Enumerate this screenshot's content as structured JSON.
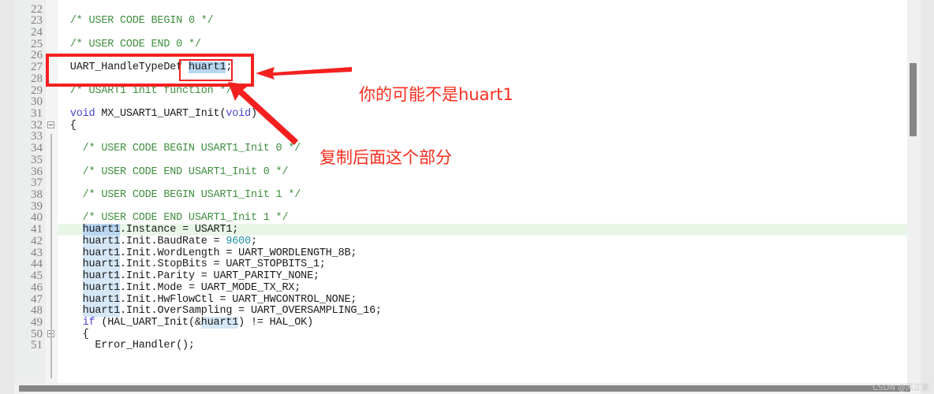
{
  "editor": {
    "first_line": 22,
    "last_line": 51,
    "lines": [
      {
        "n": 22,
        "html": ""
      },
      {
        "n": 23,
        "html": "  <span class=\"cmt\">/* USER CODE BEGIN 0 */</span>"
      },
      {
        "n": 24,
        "html": ""
      },
      {
        "n": 25,
        "html": "  <span class=\"cmt\">/* USER CODE END 0 */</span>"
      },
      {
        "n": 26,
        "html": ""
      },
      {
        "n": 27,
        "html": "  UART_HandleTypeDef <span class=\"sel\">huart1</span>;"
      },
      {
        "n": 28,
        "html": ""
      },
      {
        "n": 29,
        "html": "  <span class=\"cmt\">/* USART1 init function */</span>"
      },
      {
        "n": 30,
        "html": ""
      },
      {
        "n": 31,
        "html": "  <span class=\"kw\">void</span> MX_USART1_UART_Init(<span class=\"kw\">void</span>)"
      },
      {
        "n": 32,
        "html": "  {"
      },
      {
        "n": 33,
        "html": ""
      },
      {
        "n": 34,
        "html": "    <span class=\"cmt\">/* USER CODE BEGIN USART1_Init 0 */</span>"
      },
      {
        "n": 35,
        "html": ""
      },
      {
        "n": 36,
        "html": "    <span class=\"cmt\">/* USER CODE END USART1_Init 0 */</span>"
      },
      {
        "n": 37,
        "html": ""
      },
      {
        "n": 38,
        "html": "    <span class=\"cmt\">/* USER CODE BEGIN USART1_Init 1 */</span>"
      },
      {
        "n": 39,
        "html": ""
      },
      {
        "n": 40,
        "html": "    <span class=\"cmt\">/* USER CODE END USART1_Init 1 */</span>"
      },
      {
        "n": 41,
        "html": "    <span class=\"sel\">huart1</span>.Instance = USART1;"
      },
      {
        "n": 42,
        "html": "    <span class=\"occ\">huart1</span>.Init.BaudRate = <span class=\"num\">9600</span>;"
      },
      {
        "n": 43,
        "html": "    <span class=\"occ\">huart1</span>.Init.WordLength = UART_WORDLENGTH_8B;"
      },
      {
        "n": 44,
        "html": "    <span class=\"occ\">huart1</span>.Init.StopBits = UART_STOPBITS_1;"
      },
      {
        "n": 45,
        "html": "    <span class=\"occ\">huart1</span>.Init.Parity = UART_PARITY_NONE;"
      },
      {
        "n": 46,
        "html": "    <span class=\"occ\">huart1</span>.Init.Mode = UART_MODE_TX_RX;"
      },
      {
        "n": 47,
        "html": "    <span class=\"occ\">huart1</span>.Init.HwFlowCtl = UART_HWCONTROL_NONE;"
      },
      {
        "n": 48,
        "html": "    <span class=\"occ\">huart1</span>.Init.OverSampling = UART_OVERSAMPLING_16;"
      },
      {
        "n": 49,
        "html": "    <span class=\"kw\">if</span> (HAL_UART_Init(&amp;<span class=\"occ\">huart1</span>) != HAL_OK)"
      },
      {
        "n": 50,
        "html": "    {"
      },
      {
        "n": 51,
        "html": "      Error_Handler();"
      }
    ],
    "plain_text": [
      "",
      "/* USER CODE BEGIN 0 */",
      "",
      "/* USER CODE END 0 */",
      "",
      "UART_HandleTypeDef huart1;",
      "",
      "/* USART1 init function */",
      "",
      "void MX_USART1_UART_Init(void)",
      "{",
      "",
      "  /* USER CODE BEGIN USART1_Init 0 */",
      "",
      "  /* USER CODE END USART1_Init 0 */",
      "",
      "  /* USER CODE BEGIN USART1_Init 1 */",
      "",
      "  /* USER CODE END USART1_Init 1 */",
      "  huart1.Instance = USART1;",
      "  huart1.Init.BaudRate = 9600;",
      "  huart1.Init.WordLength = UART_WORDLENGTH_8B;",
      "  huart1.Init.StopBits = UART_STOPBITS_1;",
      "  huart1.Init.Parity = UART_PARITY_NONE;",
      "  huart1.Init.Mode = UART_MODE_TX_RX;",
      "  huart1.Init.HwFlowCtl = UART_HWCONTROL_NONE;",
      "  huart1.Init.OverSampling = UART_OVERSAMPLING_16;",
      "  if (HAL_UART_Init(&huart1) != HAL_OK)",
      "  {",
      "    Error_Handler();"
    ],
    "current_line": 41,
    "highlighted_token": "huart1",
    "fold_markers": [
      32,
      50
    ]
  },
  "annotations": {
    "note_top": "你的可能不是huart1",
    "note_bottom": "复制后面这个部分",
    "box_color": "#f42020",
    "text_color": "#fb2d1e"
  },
  "watermark": {
    "text": "CSDN @风正豪"
  },
  "colors": {
    "comment": "#3f8f3f",
    "keyword": "#4a44d4",
    "number": "#1d8fa0",
    "occurrence_highlight": "#d6e8f7",
    "selection_highlight": "#b8d6f0",
    "current_line": "#e8f6e8",
    "gutter_bg": "#eceded",
    "editor_bg": "#ffffff",
    "app_bg": "#e8e8e8"
  }
}
